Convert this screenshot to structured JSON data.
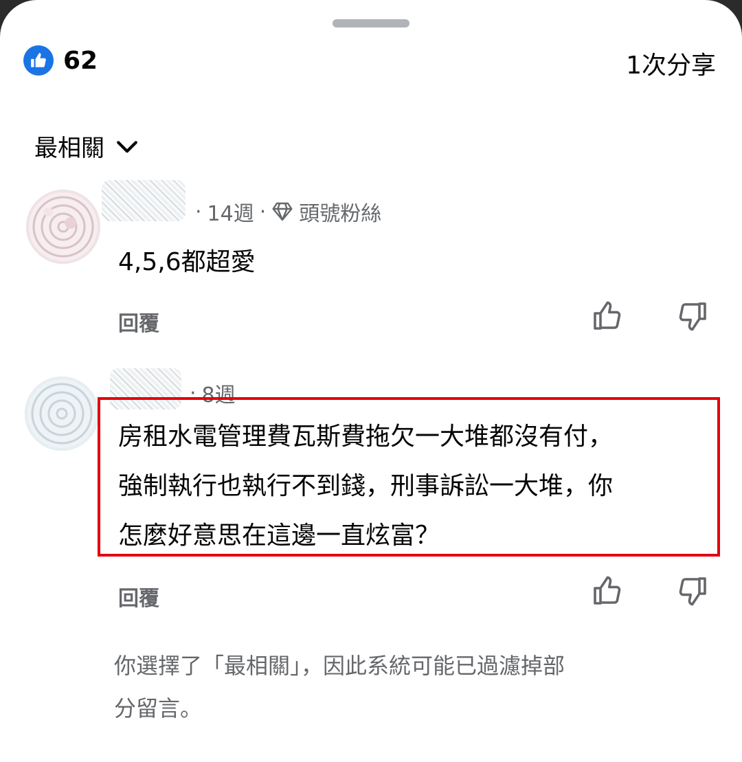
{
  "header": {
    "like_count": "62",
    "shares_label": "1次分享"
  },
  "sort": {
    "label": "最相關"
  },
  "comments": [
    {
      "time": "14週",
      "badge": "頭號粉絲",
      "text": "4,5,6都超愛",
      "reply_label": "回覆"
    },
    {
      "time": "8週",
      "text_lines": [
        "房租水電管理費瓦斯費拖欠一大堆都沒有付，",
        "強制執行也執行不到錢，刑事訴訟一大堆，你",
        "怎麼好意思在這邊一直炫富？"
      ],
      "reply_label": "回覆"
    }
  ],
  "footnote_lines": [
    "你選擇了「最相關」，因此系統可能已過濾掉部",
    "分留言。"
  ],
  "colors": {
    "accent": "#1b74e4",
    "highlight_border": "#e3000f",
    "secondary_text": "#65676b"
  },
  "icons": [
    "like-badge-icon",
    "chevron-down-icon",
    "diamond-icon",
    "thumbs-up-icon",
    "thumbs-down-icon"
  ]
}
